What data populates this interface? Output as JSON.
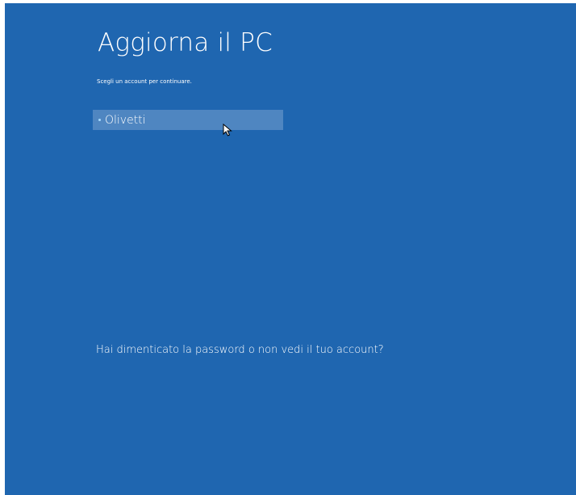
{
  "screen": {
    "title": "Aggiorna il PC",
    "subtitle": "Scegli un account per continuare.",
    "background_color": "#1f66b0"
  },
  "accounts": [
    {
      "name": "Olivetti",
      "selected": true,
      "highlight_color": "#4f86c1"
    }
  ],
  "forgot_link": {
    "label": "Hai dimenticato la password o non vedi il tuo account?"
  },
  "cursor": {
    "icon": "mouse-pointer-icon"
  }
}
